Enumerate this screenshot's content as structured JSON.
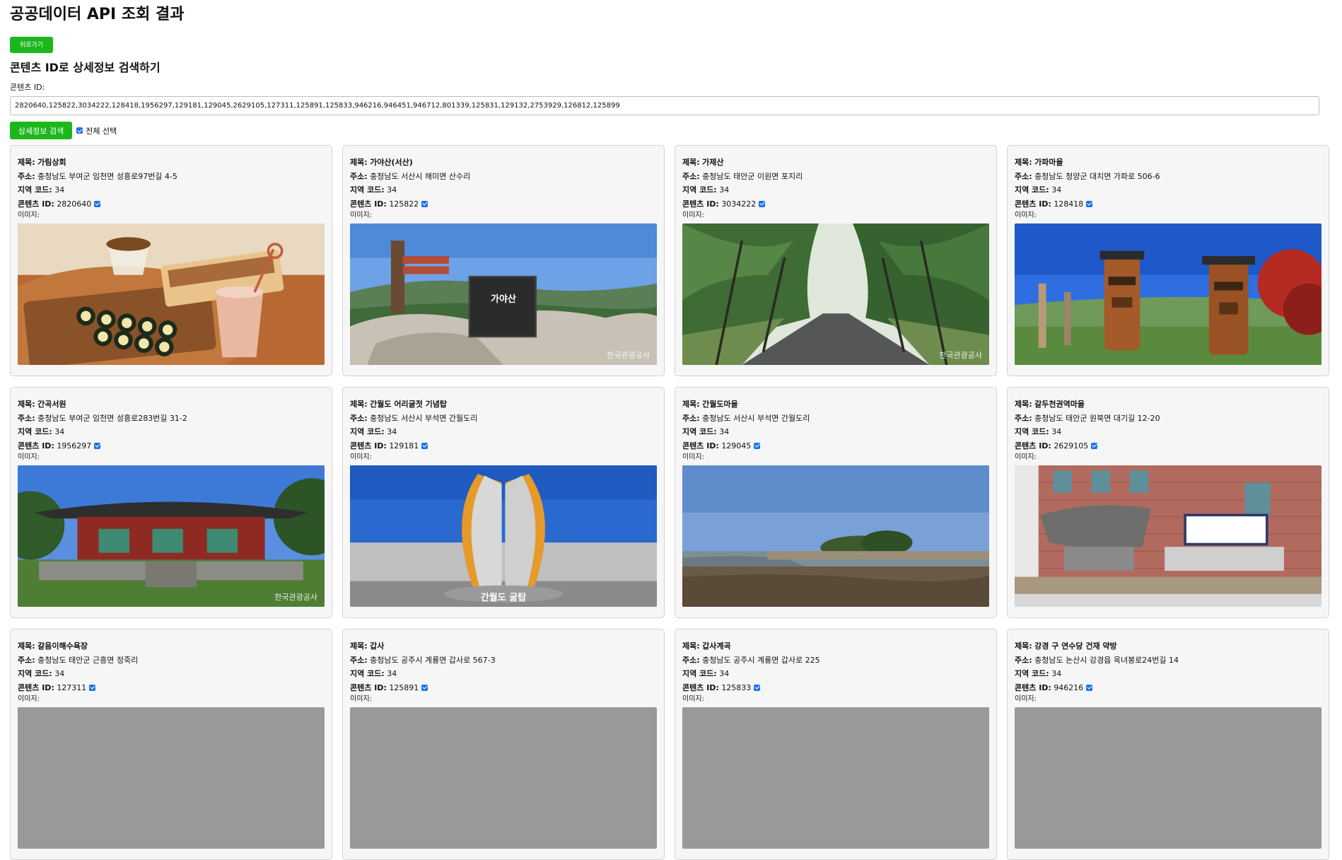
{
  "page": {
    "title": "공공데이터 API 조회 결과"
  },
  "back_button": "뒤로가기",
  "search": {
    "heading": "콘텐츠 ID로 상세정보 검색하기",
    "field_label": "콘텐츠 ID:",
    "value": "2820640,125822,3034222,128418,1956297,129181,129045,2629105,127311,125891,125833,946216,946451,946712,801339,125831,129132,2753929,126812,125899",
    "button": "상세정보 검색",
    "select_all": "전체 선택",
    "select_all_checked": true
  },
  "labels": {
    "title": "제목:",
    "address": "주소:",
    "area_code": "지역 코드:",
    "content_id": "콘텐츠 ID:",
    "image": "이미지:"
  },
  "watermark": "한국관광공사",
  "items": [
    {
      "title": "가림상회",
      "address": "충청남도 부여군 임천면 성흥로97번길 4-5",
      "area_code": "34",
      "content_id": "2820640",
      "checked": true,
      "image": "cafe-food"
    },
    {
      "title": "가야산(서산)",
      "address": "충청남도 서산시 해미면 산수리",
      "area_code": "34",
      "content_id": "125822",
      "checked": true,
      "image": "mountain-summit-stone",
      "image_text": "가야산"
    },
    {
      "title": "가제산",
      "address": "충청남도 태안군 이원면 포지리",
      "area_code": "34",
      "content_id": "3034222",
      "checked": true,
      "image": "forest-road"
    },
    {
      "title": "가파마을",
      "address": "충청남도 청양군 대치면 가파로 506-6",
      "area_code": "34",
      "content_id": "128418",
      "checked": true,
      "image": "totem-poles"
    },
    {
      "title": "간곡서원",
      "address": "충청남도 부여군 임천면 성흥로283번길 31-2",
      "area_code": "34",
      "content_id": "1956297",
      "checked": true,
      "image": "traditional-building"
    },
    {
      "title": "간월도 어리굴젓 기념탑",
      "address": "충청남도 서산시 부석면 간월도리",
      "area_code": "34",
      "content_id": "129181",
      "checked": true,
      "image": "monument-sculpture",
      "image_text": "간월도 굴탑"
    },
    {
      "title": "간월도마을",
      "address": "충청남도 서산시 부석면 간월도리",
      "area_code": "34",
      "content_id": "129045",
      "checked": true,
      "image": "island-shore"
    },
    {
      "title": "갈두천권역마을",
      "address": "충청남도 태안군 원북면 대기길 12-20",
      "area_code": "34",
      "content_id": "2629105",
      "checked": true,
      "image": "village-signboard"
    },
    {
      "title": "갈음이해수욕장",
      "address": "충청남도 태안군 근흥면 정죽리",
      "area_code": "34",
      "content_id": "127311",
      "checked": true,
      "image": "beach"
    },
    {
      "title": "갑사",
      "address": "충청남도 공주시 계룡면 갑사로 567-3",
      "area_code": "34",
      "content_id": "125891",
      "checked": true,
      "image": "temple"
    },
    {
      "title": "갑사계곡",
      "address": "충청남도 공주시 계룡면 갑사로 225",
      "area_code": "34",
      "content_id": "125833",
      "checked": true,
      "image": "valley"
    },
    {
      "title": "강경 구 연수당 건재 약방",
      "address": "충청남도 논산시 강경읍 옥녀봉로24번길 14",
      "area_code": "34",
      "content_id": "946216",
      "checked": true,
      "image": "old-building"
    }
  ]
}
